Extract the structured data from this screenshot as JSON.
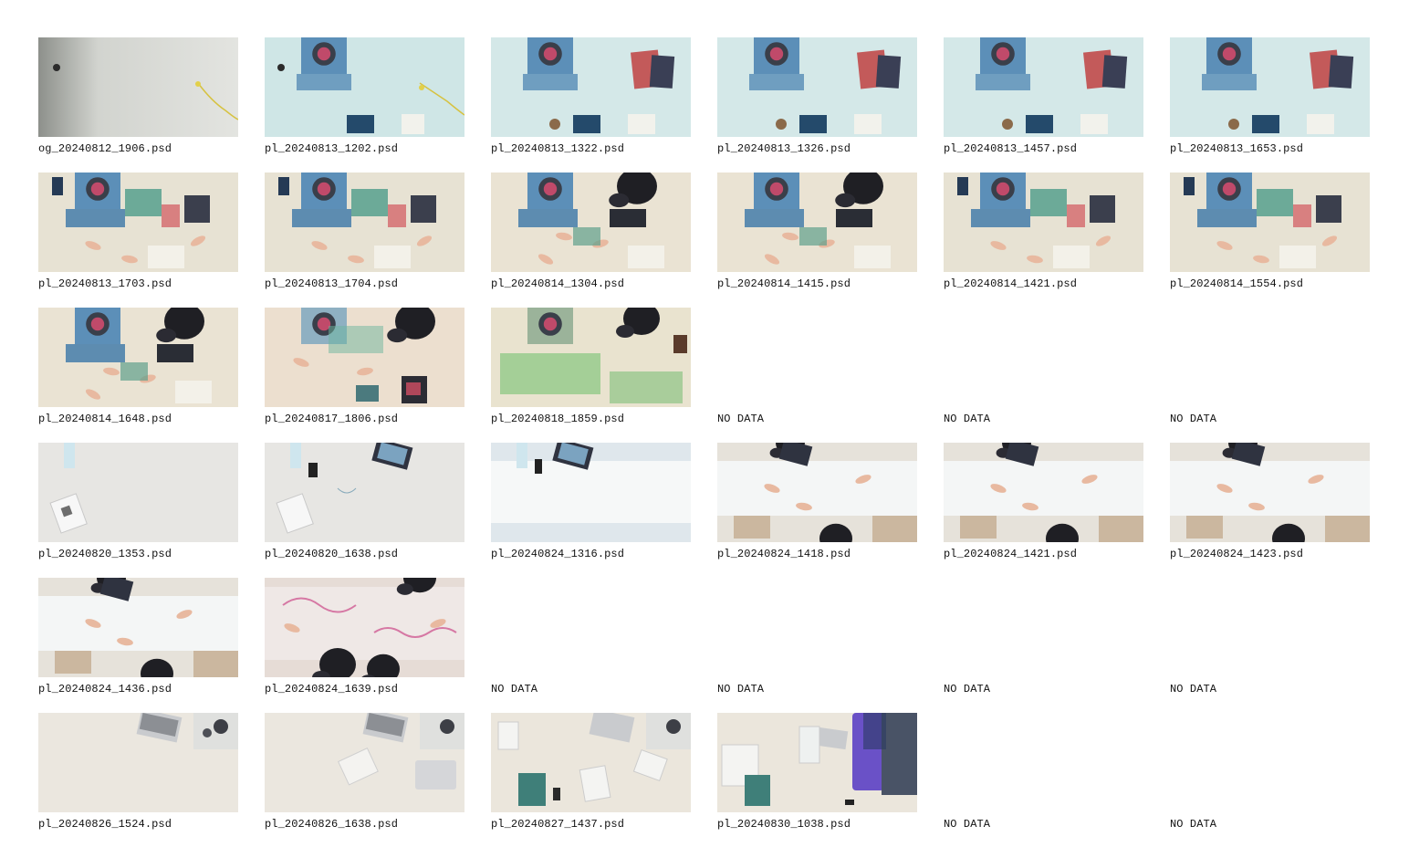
{
  "thumbnails": [
    {
      "label": "og_20240812_1906.psd",
      "has_data": true,
      "scene": "blank"
    },
    {
      "label": "pl_20240813_1202.psd",
      "has_data": true,
      "scene": "desk-cyan"
    },
    {
      "label": "pl_20240813_1322.psd",
      "has_data": true,
      "scene": "desk-cyan-books"
    },
    {
      "label": "pl_20240813_1326.psd",
      "has_data": true,
      "scene": "desk-cyan-books"
    },
    {
      "label": "pl_20240813_1457.psd",
      "has_data": true,
      "scene": "desk-cyan-books"
    },
    {
      "label": "pl_20240813_1653.psd",
      "has_data": true,
      "scene": "desk-cyan-books"
    },
    {
      "label": "pl_20240813_1703.psd",
      "has_data": true,
      "scene": "desk-busy"
    },
    {
      "label": "pl_20240813_1704.psd",
      "has_data": true,
      "scene": "desk-busy"
    },
    {
      "label": "pl_20240814_1304.psd",
      "has_data": true,
      "scene": "desk-people"
    },
    {
      "label": "pl_20240814_1415.psd",
      "has_data": true,
      "scene": "desk-people"
    },
    {
      "label": "pl_20240814_1421.psd",
      "has_data": true,
      "scene": "desk-busy"
    },
    {
      "label": "pl_20240814_1554.psd",
      "has_data": true,
      "scene": "desk-busy"
    },
    {
      "label": "pl_20240814_1648.psd",
      "has_data": true,
      "scene": "desk-people"
    },
    {
      "label": "pl_20240817_1806.psd",
      "has_data": true,
      "scene": "desk-faded"
    },
    {
      "label": "pl_20240818_1859.psd",
      "has_data": true,
      "scene": "desk-green"
    },
    {
      "label": "NO DATA",
      "has_data": false,
      "scene": "none"
    },
    {
      "label": "NO DATA",
      "has_data": false,
      "scene": "none"
    },
    {
      "label": "NO DATA",
      "has_data": false,
      "scene": "none"
    },
    {
      "label": "pl_20240820_1353.psd",
      "has_data": true,
      "scene": "blank-paper"
    },
    {
      "label": "pl_20240820_1638.psd",
      "has_data": true,
      "scene": "blank-tablet"
    },
    {
      "label": "pl_20240824_1316.psd",
      "has_data": true,
      "scene": "scroll-paper"
    },
    {
      "label": "pl_20240824_1418.psd",
      "has_data": true,
      "scene": "scroll-people"
    },
    {
      "label": "pl_20240824_1421.psd",
      "has_data": true,
      "scene": "scroll-people"
    },
    {
      "label": "pl_20240824_1423.psd",
      "has_data": true,
      "scene": "scroll-people"
    },
    {
      "label": "pl_20240824_1436.psd",
      "has_data": true,
      "scene": "scroll-people"
    },
    {
      "label": "pl_20240824_1639.psd",
      "has_data": true,
      "scene": "scroll-pink"
    },
    {
      "label": "NO DATA",
      "has_data": false,
      "scene": "none"
    },
    {
      "label": "NO DATA",
      "has_data": false,
      "scene": "none"
    },
    {
      "label": "NO DATA",
      "has_data": false,
      "scene": "none"
    },
    {
      "label": "NO DATA",
      "has_data": false,
      "scene": "none"
    },
    {
      "label": "pl_20240826_1524.psd",
      "has_data": true,
      "scene": "laptop"
    },
    {
      "label": "pl_20240826_1638.psd",
      "has_data": true,
      "scene": "laptop-2"
    },
    {
      "label": "pl_20240827_1437.psd",
      "has_data": true,
      "scene": "laptop-papers"
    },
    {
      "label": "pl_20240830_1038.psd",
      "has_data": true,
      "scene": "mat-purple"
    },
    {
      "label": "NO DATA",
      "has_data": false,
      "scene": "none"
    },
    {
      "label": "NO DATA",
      "has_data": false,
      "scene": "none"
    }
  ],
  "colors": {
    "background": "#ffffff",
    "caption": "#111111"
  }
}
